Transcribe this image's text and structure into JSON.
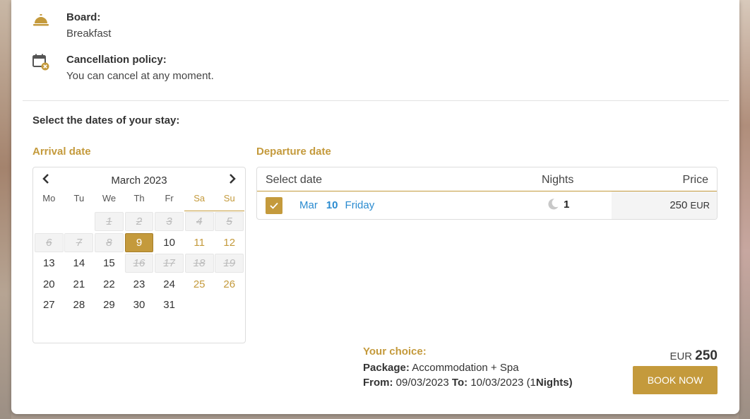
{
  "board": {
    "label": "Board:",
    "value": "Breakfast",
    "icon": "service-bell-icon"
  },
  "cancellation": {
    "label": "Cancellation policy:",
    "value": "You can cancel at any moment.",
    "icon": "calendar-cancel-icon"
  },
  "dates_section": {
    "title": "Select the dates of your stay:"
  },
  "arrival": {
    "label": "Arrival date",
    "month_title": "March 2023",
    "days_of_week": [
      "Mo",
      "Tu",
      "We",
      "Th",
      "Fr",
      "Sa",
      "Su"
    ],
    "weeks": [
      [
        {
          "d": ""
        },
        {
          "d": ""
        },
        {
          "d": "1",
          "s": "disabled"
        },
        {
          "d": "2",
          "s": "disabled"
        },
        {
          "d": "3",
          "s": "disabled"
        },
        {
          "d": "4",
          "s": "disabled"
        },
        {
          "d": "5",
          "s": "disabled"
        }
      ],
      [
        {
          "d": "6",
          "s": "disabled"
        },
        {
          "d": "7",
          "s": "disabled"
        },
        {
          "d": "8",
          "s": "disabled"
        },
        {
          "d": "9",
          "s": "selected"
        },
        {
          "d": "10"
        },
        {
          "d": "11",
          "s": "weekend"
        },
        {
          "d": "12",
          "s": "weekend"
        }
      ],
      [
        {
          "d": "13"
        },
        {
          "d": "14"
        },
        {
          "d": "15"
        },
        {
          "d": "16",
          "s": "disabled"
        },
        {
          "d": "17",
          "s": "disabled"
        },
        {
          "d": "18",
          "s": "disabled"
        },
        {
          "d": "19",
          "s": "disabled"
        }
      ],
      [
        {
          "d": "20"
        },
        {
          "d": "21"
        },
        {
          "d": "22"
        },
        {
          "d": "23"
        },
        {
          "d": "24"
        },
        {
          "d": "25",
          "s": "weekend"
        },
        {
          "d": "26",
          "s": "weekend"
        }
      ],
      [
        {
          "d": "27"
        },
        {
          "d": "28"
        },
        {
          "d": "29"
        },
        {
          "d": "30"
        },
        {
          "d": "31"
        },
        {
          "d": ""
        },
        {
          "d": ""
        }
      ]
    ]
  },
  "departure": {
    "label": "Departure date",
    "columns": {
      "date": "Select date",
      "nights": "Nights",
      "price": "Price"
    },
    "rows": [
      {
        "month": "Mar",
        "day": "10",
        "weekday": "Friday",
        "nights": "1",
        "price": "250",
        "currency": "EUR",
        "checked": true
      }
    ]
  },
  "summary": {
    "heading": "Your choice:",
    "package_label": "Package:",
    "package_value": "Accommodation + Spa",
    "from_label": "From:",
    "from_value": "09/03/2023",
    "to_label": "To:",
    "to_value": "10/03/2023",
    "nights_open": "(1",
    "nights_word": "Nights)"
  },
  "total": {
    "currency": "EUR",
    "amount": "250"
  },
  "book_button": {
    "label": "BOOK NOW"
  },
  "colors": {
    "accent": "#c49a3c",
    "link": "#2a8bd0"
  }
}
